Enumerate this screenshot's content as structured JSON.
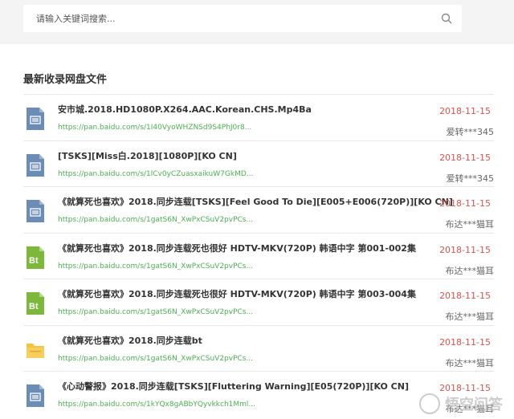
{
  "search": {
    "placeholder": "请输入关键词搜索..."
  },
  "section": {
    "title": "最新收录网盘文件"
  },
  "files": [
    {
      "icon": "video-file-icon",
      "name": "安市城.2018.HD1080P.X264.AAC.Korean.CHS.Mp4Ba",
      "link": "https://pan.baidu.com/s/1I40VyoWHZNSd9S4PhJ0r8...",
      "date": "2018-11-15",
      "user": "爱转***345"
    },
    {
      "icon": "video-file-icon",
      "name": "[TSKS][Miss白.2018][1080P][KO CN]",
      "link": "https://pan.baidu.com/s/1lCv0yCZuasxaikuW7GkMD...",
      "date": "2018-11-15",
      "user": "爱转***345"
    },
    {
      "icon": "video-file-icon",
      "name": "《就算死也喜欢》2018.同步连载[TSKS][Feel Good To Die][E005+E006(720P)][KO CN]",
      "link": "https://pan.baidu.com/s/1gatS6N_XwPxCSuV2pvPCs...",
      "date": "2018-11-15",
      "user": "布达***猫耳"
    },
    {
      "icon": "bt-file-icon",
      "name": "《就算死也喜欢》2018.同步连载死也很好 HDTV-MKV(720P) 韩语中字 第001-002集",
      "link": "https://pan.baidu.com/s/1gatS6N_XwPxCSuV2pvPCs...",
      "date": "2018-11-15",
      "user": "布达***猫耳"
    },
    {
      "icon": "bt-file-icon",
      "name": "《就算死也喜欢》2018.同步连载死也很好 HDTV-MKV(720P) 韩语中字 第003-004集",
      "link": "https://pan.baidu.com/s/1gatS6N_XwPxCSuV2pvPCs...",
      "date": "2018-11-15",
      "user": "布达***猫耳"
    },
    {
      "icon": "folder-icon",
      "name": "《就算死也喜欢》2018.同步连载bt",
      "link": "https://pan.baidu.com/s/1gatS6N_XwPxCSuV2pvPCs...",
      "date": "2018-11-15",
      "user": "布达***猫耳"
    },
    {
      "icon": "video-file-icon",
      "name": "《心动警报》2018.同步连载[TSKS][Fluttering Warning][E05(720P)][KO CN]",
      "link": "https://pan.baidu.com/s/1kYQx8gABbYQyvkkch1Mml...",
      "date": "2018-11-15",
      "user": "布达***猫耳"
    }
  ],
  "watermark": {
    "text": "悟空问答"
  },
  "colors": {
    "link": "#4caf50",
    "date": "#d9534f",
    "video_icon": "#6b8db5",
    "bt_icon": "#7cb83a",
    "folder_icon": "#f5c242"
  }
}
